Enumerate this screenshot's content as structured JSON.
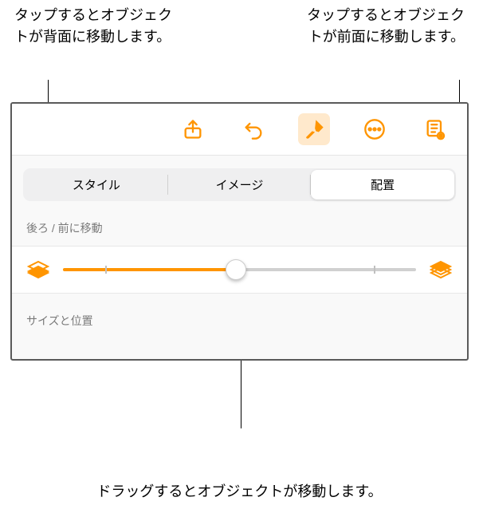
{
  "callouts": {
    "top_left": "タップするとオブジェクトが背面に移動します。",
    "top_right": "タップするとオブジェクトが前面に移動します。",
    "bottom": "ドラッグするとオブジェクトが移動します。"
  },
  "toolbar": {
    "share": "share-icon",
    "undo": "undo-icon",
    "format": "format-brush-icon",
    "more": "more-icon",
    "view": "reading-view-icon"
  },
  "tabs": {
    "style": "スタイル",
    "image": "イメージ",
    "arrange": "配置"
  },
  "panel": {
    "move_label": "後ろ / 前に移動",
    "size_pos_label": "サイズと位置"
  },
  "colors": {
    "accent": "#ff9500"
  }
}
